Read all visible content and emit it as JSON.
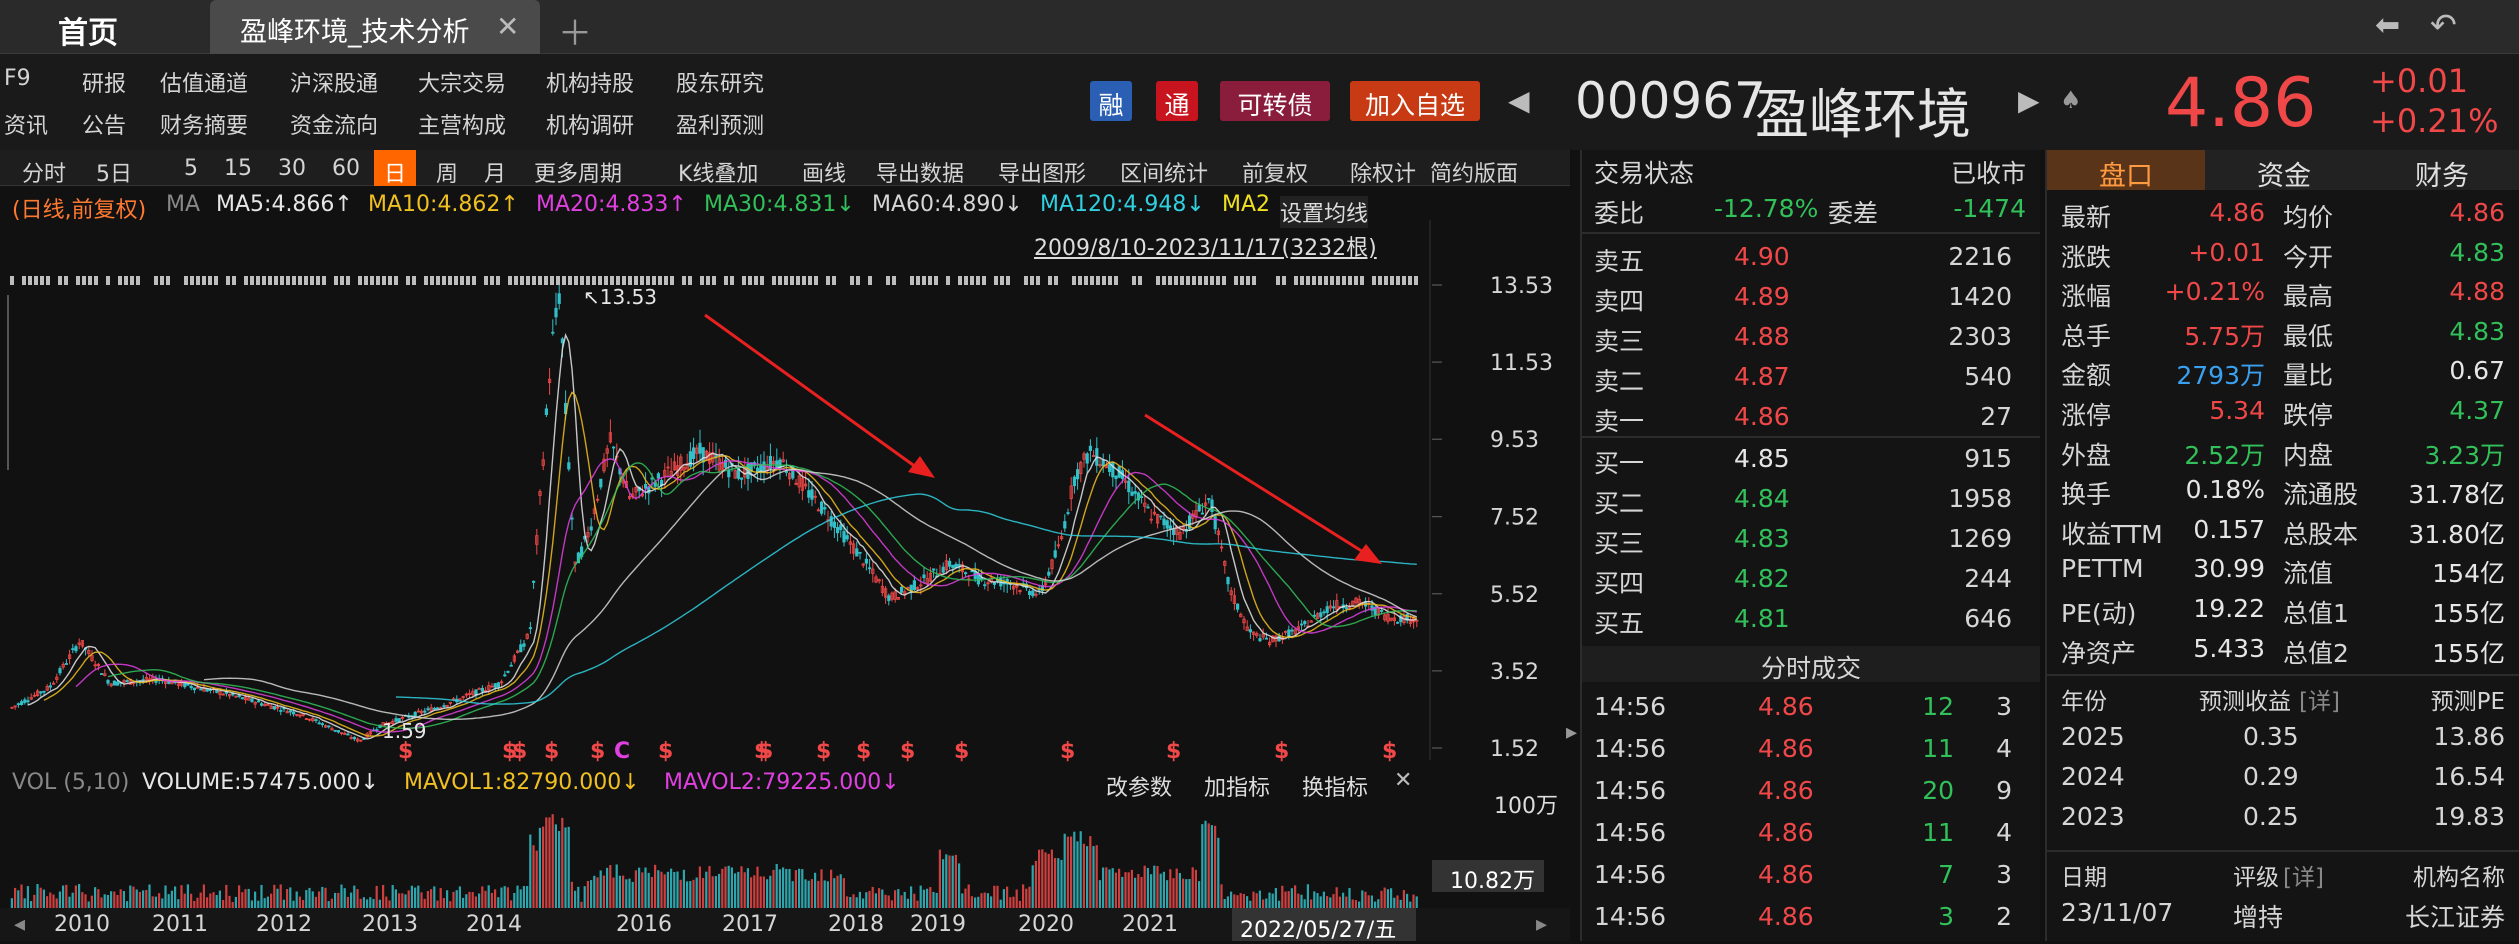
{
  "tabbar": {
    "home": "首页",
    "tab": "盈峰环境_技术分析",
    "close": "✕",
    "add": "＋",
    "back": "⬅",
    "undo": "↶"
  },
  "menu": {
    "f9": "F9",
    "zixun": "资讯",
    "row1": [
      "研报",
      "估值通道",
      "沪深股通",
      "大宗交易",
      "机构持股",
      "股东研究"
    ],
    "row2": [
      "公告",
      "财务摘要",
      "资金流向",
      "主营构成",
      "机构调研",
      "盈利预测"
    ]
  },
  "header": {
    "tags": [
      "融",
      "通",
      "可转债",
      "加入自选"
    ],
    "code": "000967",
    "name": "盈峰环境",
    "price": "4.86",
    "change": "+0.01",
    "change_pct": "+0.21%"
  },
  "toolbar": {
    "items": [
      "分时",
      "5日",
      "5",
      "15",
      "30",
      "60",
      "日",
      "周",
      "月",
      "更多周期",
      "K线叠加",
      "画线",
      "导出数据",
      "导出图形",
      "区间统计",
      "前复权",
      "除权计",
      "简约版面"
    ]
  },
  "ma_legend": {
    "label": "(日线,前复权)",
    "ma": "MA",
    "ma5": "MA5:4.866↑",
    "ma10": "MA10:4.862↑",
    "ma20": "MA20:4.833↑",
    "ma30": "MA30:4.831↓",
    "ma60": "MA60:4.890↓",
    "ma120": "MA120:4.948↓",
    "ma2": "MA2",
    "set": "设置均线",
    "range": "2009/8/10-2023/11/17(3232根)"
  },
  "chart": {
    "yticks": [
      "13.53",
      "11.53",
      "9.53",
      "7.52",
      "5.52",
      "3.52",
      "1.52"
    ],
    "high_label": "↖13.53",
    "low_label": "1.59",
    "xlabels": [
      "2010",
      "2011",
      "2012",
      "2013",
      "2014",
      "2016",
      "2017",
      "2018",
      "2019",
      "2020",
      "2021"
    ],
    "cursor_date": "2022/05/27/五"
  },
  "volume": {
    "title": "VOL (5,10)",
    "volume": "VOLUME:57475.000↓",
    "mavol1": "MAVOL1:82790.000↓",
    "mavol2": "MAVOL2:79225.000↓",
    "actions": [
      "改参数",
      "加指标",
      "换指标"
    ],
    "close": "✕",
    "axis_top": "100万",
    "current": "10.82万"
  },
  "orderbook": {
    "status_label": "交易状态",
    "status": "已收市",
    "wb_label": "委比",
    "wb": "-12.78%",
    "wc_label": "委差",
    "wc": "-1474",
    "sell": [
      [
        "卖五",
        "4.90",
        "2216"
      ],
      [
        "卖四",
        "4.89",
        "1420"
      ],
      [
        "卖三",
        "4.88",
        "2303"
      ],
      [
        "卖二",
        "4.87",
        "540"
      ],
      [
        "卖一",
        "4.86",
        "27"
      ]
    ],
    "buy": [
      [
        "买一",
        "4.85",
        "915"
      ],
      [
        "买二",
        "4.84",
        "1958"
      ],
      [
        "买三",
        "4.83",
        "1269"
      ],
      [
        "买四",
        "4.82",
        "244"
      ],
      [
        "买五",
        "4.81",
        "646"
      ]
    ],
    "ticks_title": "分时成交",
    "ticks": [
      [
        "14:56",
        "4.86",
        "12",
        "3"
      ],
      [
        "14:56",
        "4.86",
        "11",
        "4"
      ],
      [
        "14:56",
        "4.86",
        "20",
        "9"
      ],
      [
        "14:56",
        "4.86",
        "11",
        "4"
      ],
      [
        "14:56",
        "4.86",
        "7",
        "3"
      ],
      [
        "14:56",
        "4.86",
        "3",
        "2"
      ]
    ]
  },
  "quote": {
    "tabs": [
      "盘口",
      "资金",
      "财务"
    ],
    "rows": [
      [
        "最新",
        "4.86",
        "均价",
        "4.86"
      ],
      [
        "涨跌",
        "+0.01",
        "今开",
        "4.83"
      ],
      [
        "涨幅",
        "+0.21%",
        "最高",
        "4.88"
      ],
      [
        "总手",
        "5.75万",
        "最低",
        "4.83"
      ],
      [
        "金额",
        "2793万",
        "量比",
        "0.67"
      ],
      [
        "涨停",
        "5.34",
        "跌停",
        "4.37"
      ],
      [
        "外盘",
        "2.52万",
        "内盘",
        "3.23万"
      ],
      [
        "换手",
        "0.18%",
        "流通股",
        "31.78亿"
      ],
      [
        "收益TTM",
        "0.157",
        "总股本",
        "31.80亿"
      ],
      [
        "PETTM",
        "30.99",
        "流值",
        "154亿"
      ],
      [
        "PE(动)",
        "19.22",
        "总值1",
        "155亿"
      ],
      [
        "净资产",
        "5.433",
        "总值2",
        "155亿"
      ]
    ],
    "forecast_header": [
      "年份",
      "预测收益",
      "[详]",
      "预测PE"
    ],
    "forecast": [
      [
        "2025",
        "0.35",
        "13.86"
      ],
      [
        "2024",
        "0.29",
        "16.54"
      ],
      [
        "2023",
        "0.25",
        "19.83"
      ]
    ],
    "rating_header": [
      "日期",
      "评级",
      "[详]",
      "机构名称"
    ],
    "rating": [
      [
        "23/11/07",
        "增持",
        "长江证券"
      ]
    ]
  },
  "colors": {
    "up": "#f04848",
    "down": "#32c05a",
    "accent": "#ff6600",
    "bg": "#111111"
  },
  "chart_data": {
    "type": "candlestick",
    "title": "",
    "ylim": [
      1.52,
      13.53
    ],
    "high": 13.53,
    "low": 1.59,
    "x_range": "2009/8/10-2023/11/17",
    "last_close": 4.86,
    "ma": {
      "MA5": 4.866,
      "MA10": 4.862,
      "MA20": 4.833,
      "MA30": 4.831,
      "MA60": 4.89,
      "MA120": 4.948
    }
  }
}
